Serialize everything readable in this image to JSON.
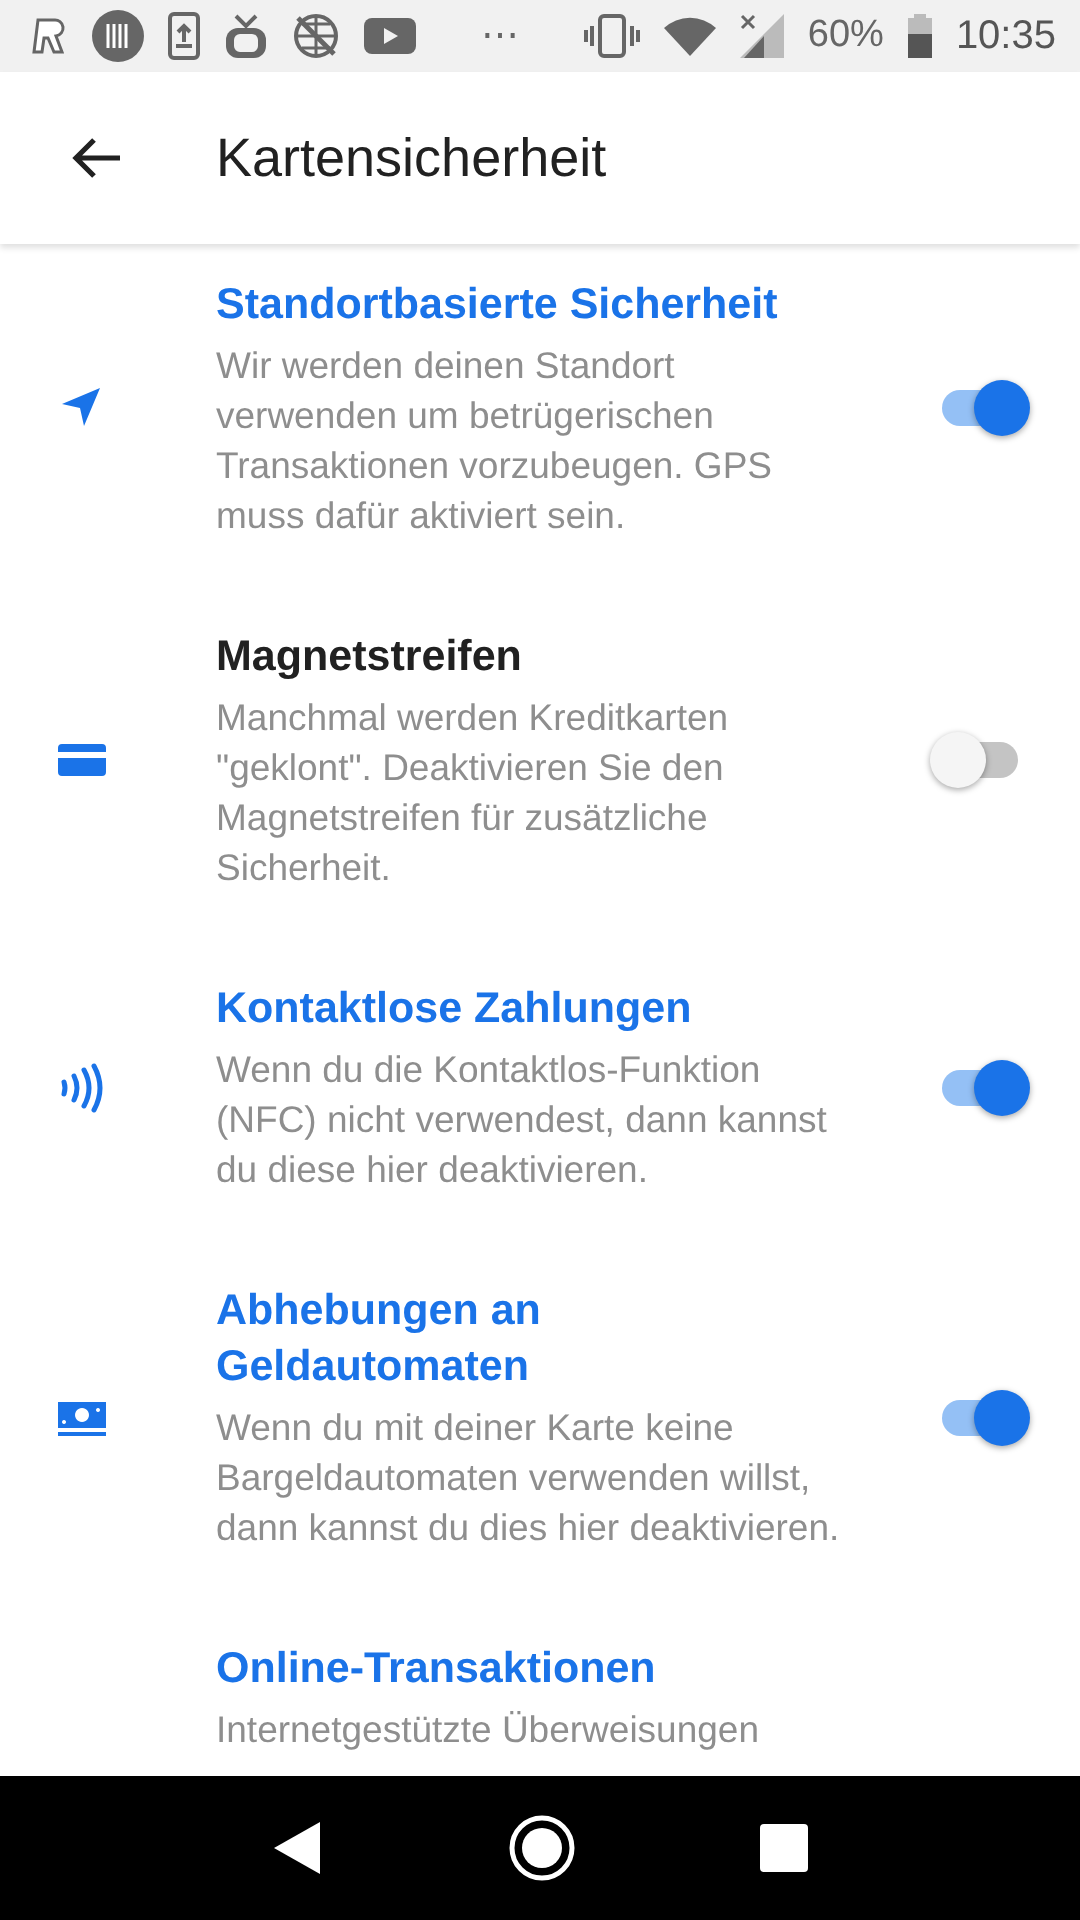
{
  "status_bar": {
    "overflow": "⋯",
    "battery": "60%",
    "time": "10:35"
  },
  "app_bar": {
    "title": "Kartensicherheit"
  },
  "settings": [
    {
      "title": "Standortbasierte Sicherheit",
      "description": "Wir werden deinen Standort verwenden um betrügerischen Transaktionen vorzubeugen. GPS muss dafür aktiviert sein.",
      "on": true
    },
    {
      "title": "Magnetstreifen",
      "description": "Manchmal werden Kreditkarten \"geklont\". Deaktivieren Sie den Magnetstreifen für zusätzliche Sicherheit.",
      "on": false
    },
    {
      "title": "Kontaktlose Zahlungen",
      "description": "Wenn du die Kontaktlos-Funktion (NFC) nicht verwendest, dann kannst du diese hier deaktivieren.",
      "on": true
    },
    {
      "title": "Abhebungen an Geldautomaten",
      "description": "Wenn du mit deiner Karte keine Bargeldautomaten verwenden willst, dann kannst du dies hier deaktivieren.",
      "on": true
    },
    {
      "title": "Online-Transaktionen",
      "description": "Internetgestützte Überweisungen"
    }
  ]
}
